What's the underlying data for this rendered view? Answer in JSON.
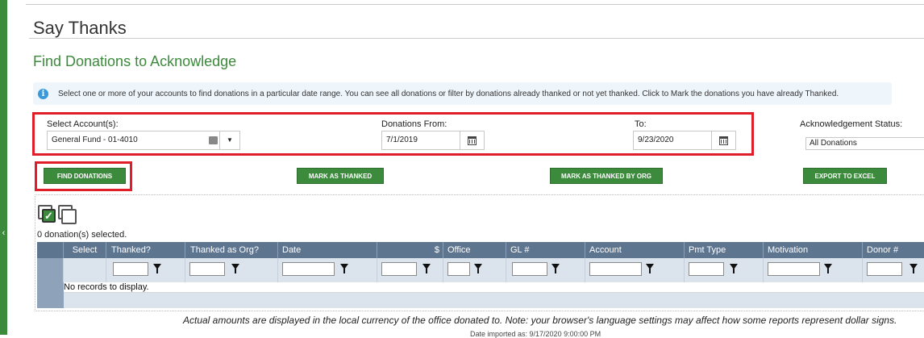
{
  "page": {
    "title": "Say Thanks",
    "section_title": "Find Donations to Acknowledge",
    "info_text": "Select one or more of your accounts to find donations in a particular date range. You can see all donations or filter by donations already thanked or not yet thanked. Click to Mark the donations you have already Thanked.",
    "footnote": "Actual amounts are displayed in the local currency of the office donated to. Note: your browser's language settings may affect how some reports represent dollar signs.",
    "date_imported": "Date imported as: 9/17/2020 9:00:00 PM"
  },
  "criteria": {
    "account_label": "Select Account(s):",
    "account_value": "General Fund - 01-4010",
    "from_label": "Donations From:",
    "from_value": "7/1/2019",
    "to_label": "To:",
    "to_value": "9/23/2020",
    "status_label": "Acknowledgement Status:",
    "status_value": "All Donations"
  },
  "buttons": {
    "find": "FIND DONATIONS",
    "mark_thanked": "MARK AS THANKED",
    "mark_thanked_org": "MARK AS THANKED BY ORG",
    "export": "EXPORT TO EXCEL"
  },
  "grid": {
    "selected_count": "0 donation(s) selected.",
    "columns": [
      "Select",
      "Thanked?",
      "Thanked as Org?",
      "Date",
      "$",
      "Office",
      "GL #",
      "Account",
      "Pmt Type",
      "Motivation",
      "Donor #"
    ],
    "empty_message": "No records to display."
  },
  "colors": {
    "brand_green": "#3c8a3c",
    "highlight_red": "#e01e2a",
    "grid_header": "#5e7590"
  },
  "icons": [
    "info-icon",
    "calendar-icon",
    "dropdown-arrow-icon",
    "select-all-icon",
    "deselect-all-icon",
    "filter-icon",
    "collapse-sidebar-icon"
  ]
}
